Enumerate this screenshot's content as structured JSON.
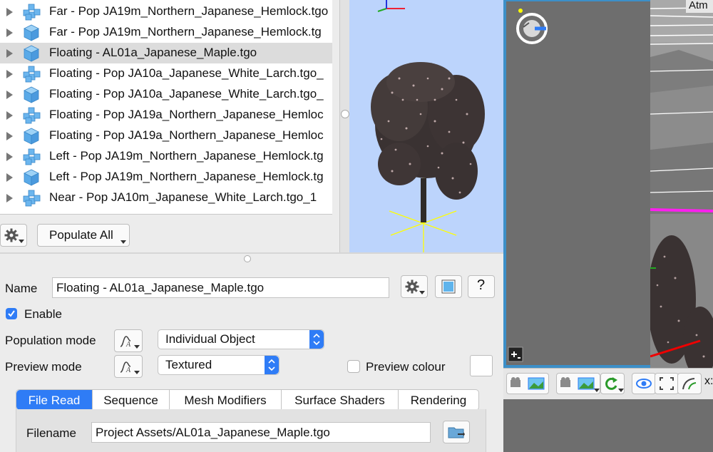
{
  "object_list": {
    "items": [
      {
        "label": "Far - Pop JA19m_Northern_Japanese_Hemlock.tgo",
        "icon": "population-cubes-icon",
        "selected": false
      },
      {
        "label": "Far - Pop JA19m_Northern_Japanese_Hemlock.tg",
        "icon": "object-cube-icon",
        "selected": false
      },
      {
        "label": "Floating - AL01a_Japanese_Maple.tgo",
        "icon": "object-cube-icon",
        "selected": true
      },
      {
        "label": "Floating - Pop JA10a_Japanese_White_Larch.tgo_",
        "icon": "population-cubes-icon",
        "selected": false
      },
      {
        "label": "Floating - Pop JA10a_Japanese_White_Larch.tgo_",
        "icon": "object-cube-icon",
        "selected": false
      },
      {
        "label": "Floating - Pop JA19a_Northern_Japanese_Hemloc",
        "icon": "population-cubes-icon",
        "selected": false
      },
      {
        "label": "Floating - Pop JA19a_Northern_Japanese_Hemloc",
        "icon": "object-cube-icon",
        "selected": false
      },
      {
        "label": "Left - Pop JA19m_Northern_Japanese_Hemlock.tg",
        "icon": "population-cubes-icon",
        "selected": false
      },
      {
        "label": "Left - Pop JA19m_Northern_Japanese_Hemlock.tg",
        "icon": "object-cube-icon",
        "selected": false
      },
      {
        "label": "Near - Pop JA10m_Japanese_White_Larch.tgo_1",
        "icon": "population-cubes-icon",
        "selected": false
      }
    ],
    "populate_all_label": "Populate All"
  },
  "viewport": {
    "overlay_label": "Atm"
  },
  "properties": {
    "name_label": "Name",
    "name_value": "Floating - AL01a_Japanese_Maple.tgo",
    "enable_label": "Enable",
    "enable_checked": true,
    "population_mode_label": "Population mode",
    "population_mode_value": "Individual Object",
    "preview_mode_label": "Preview mode",
    "preview_mode_value": "Textured",
    "preview_colour_label": "Preview colour",
    "help_label": "?",
    "tabs": [
      "File Read",
      "Sequence",
      "Mesh Modifiers",
      "Surface Shaders",
      "Rendering"
    ],
    "active_tab": "File Read",
    "filename_label": "Filename",
    "filename_value": "Project Assets/AL01a_Japanese_Maple.tgo"
  },
  "colors": {
    "accent": "#2f7cf6",
    "selection_row": "#dcdcdc",
    "preview_sky": "#bcd4fc",
    "viewport_frame": "#3c8fc8"
  }
}
